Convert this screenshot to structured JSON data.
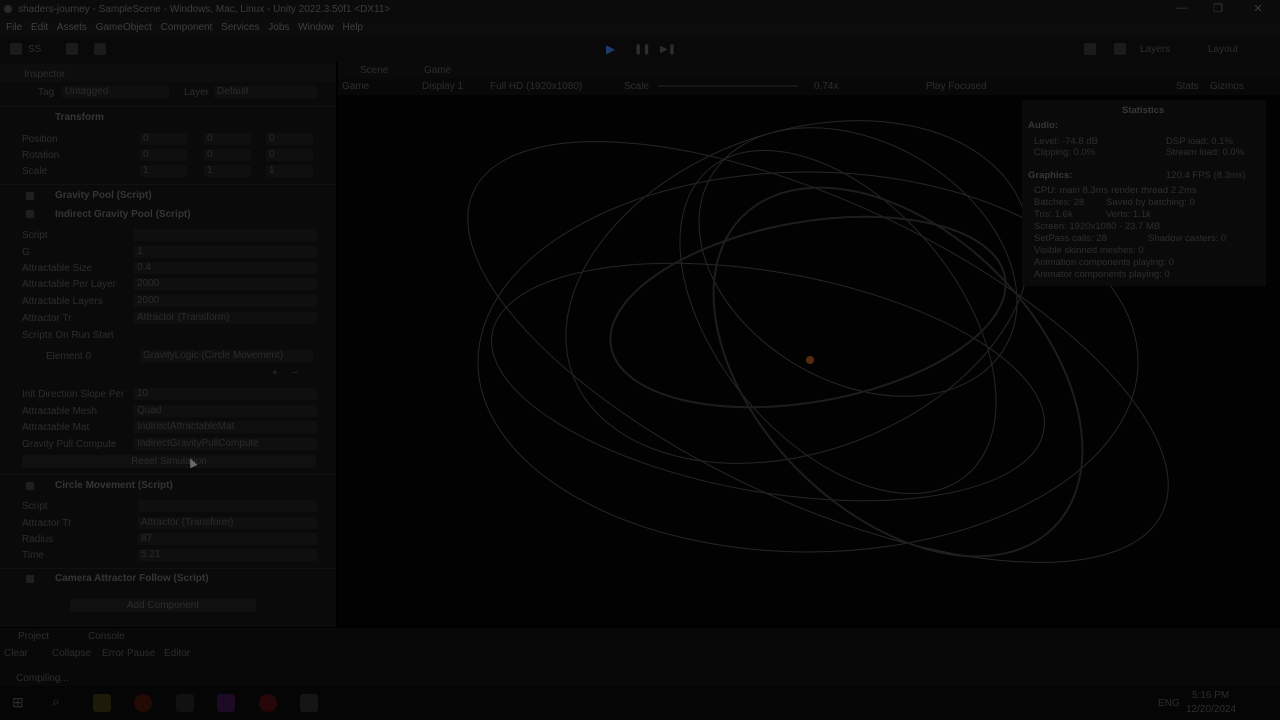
{
  "window": {
    "title": "shaders-journey - SampleScene - Windows, Mac, Linux - Unity 2022.3.50f1 <DX11>",
    "controls": [
      "—",
      "❐",
      "✕"
    ]
  },
  "menu": [
    "File",
    "Edit",
    "Assets",
    "GameObject",
    "Component",
    "Services",
    "Jobs",
    "Window",
    "Help"
  ],
  "toolbar": {
    "account_label": "SS",
    "layers_label": "Layers",
    "layout_label": "Layout",
    "play": "▶",
    "pause": "❚❚",
    "step": "▶❚"
  },
  "inspector": {
    "tab_label": "Inspector",
    "tag_label": "Tag",
    "tag_value": "Untagged",
    "layer_label": "Layer",
    "layer_value": "Default",
    "transform": {
      "title": "Transform",
      "rows": [
        {
          "label": "Position",
          "x": "0",
          "y": "0",
          "z": "0"
        },
        {
          "label": "Rotation",
          "x": "0",
          "y": "0",
          "z": "0"
        },
        {
          "label": "Scale",
          "x": "1",
          "y": "1",
          "z": "1"
        }
      ]
    },
    "gravity_pool_title": "Gravity Pool (Script)",
    "indirect_title": "Indirect Gravity Pool (Script)",
    "indirect_fields": [
      {
        "label": "Script",
        "value": ""
      },
      {
        "label": "G",
        "value": "1"
      },
      {
        "label": "Attractable Size",
        "value": "0.4"
      },
      {
        "label": "Attractable Per Layer",
        "value": "2000"
      },
      {
        "label": "Attractable Layers",
        "value": "2000"
      },
      {
        "label": "Attractor Tr",
        "value": "Attractor (Transform)"
      }
    ],
    "scripts_on_run_start": "Scripts On Run Start",
    "element0_label": "Element 0",
    "element0_value": "GravityLogic (Circle Movement)",
    "lower_fields": [
      {
        "label": "Init Direction Slope Per",
        "value": "10"
      },
      {
        "label": "Attractable Mesh",
        "value": "Quad"
      },
      {
        "label": "Attractable Mat",
        "value": "IndirectAttractableMat"
      },
      {
        "label": "Gravity Pull Compute",
        "value": "IndirectGravityPullCompute"
      }
    ],
    "reset_button": "Reset Simulation",
    "circle_title": "Circle Movement (Script)",
    "circle_fields": [
      {
        "label": "Script",
        "value": ""
      },
      {
        "label": "Attractor Tr",
        "value": "Attractor (Transform)"
      },
      {
        "label": "Radius",
        "value": "87"
      },
      {
        "label": "Time",
        "value": "5.21"
      }
    ],
    "camera_title": "Camera Attractor Follow (Script)",
    "add_component": "Add Component"
  },
  "game": {
    "tabs": [
      "Scene",
      "Game"
    ],
    "mode": "Game",
    "display": "Display 1",
    "resolution": "Full HD (1920x1080)",
    "scale_label": "Scale",
    "scale_value": "0.74x",
    "play_focus": "Play Focused",
    "stats_label": "Stats",
    "gizmos_label": "Gizmos"
  },
  "statistics": {
    "title": "Statistics",
    "audio_header": "Audio:",
    "audio": [
      {
        "l": "Level: -74.8 dB",
        "r": "DSP load: 0.1%"
      },
      {
        "l": "Clipping: 0.0%",
        "r": "Stream load: 0.0%"
      }
    ],
    "graphics_header": "Graphics:",
    "fps": "120.4 FPS (8.3ms)",
    "graphics": [
      {
        "l": "CPU: main 8.3ms  render thread 2.2ms",
        "r": ""
      },
      {
        "l": "Batches: 28",
        "r": "Saved by batching: 0"
      },
      {
        "l": "Tris: 1.6k",
        "r": "Verts: 1.1k"
      },
      {
        "l": "Screen: 1920x1080 - 23.7 MB",
        "r": ""
      },
      {
        "l": "SetPass calls: 28",
        "r": "Shadow casters: 0"
      },
      {
        "l": "Visible skinned meshes: 0",
        "r": ""
      },
      {
        "l": "Animation components playing: 0",
        "r": ""
      },
      {
        "l": "Animator components playing: 0",
        "r": ""
      }
    ]
  },
  "bottom": {
    "tabs": [
      "Project",
      "Console"
    ],
    "console_buttons": [
      "Clear",
      "Collapse",
      "Error Pause",
      "Editor"
    ],
    "status": "Compiling..."
  },
  "taskbar": {
    "lang": "ENG",
    "time": "5:16 PM",
    "date": "12/20/2024"
  },
  "colors": {
    "accent": "#1d3a6a",
    "particle": "#3a3a3a",
    "attractor": "#5a2a10"
  }
}
